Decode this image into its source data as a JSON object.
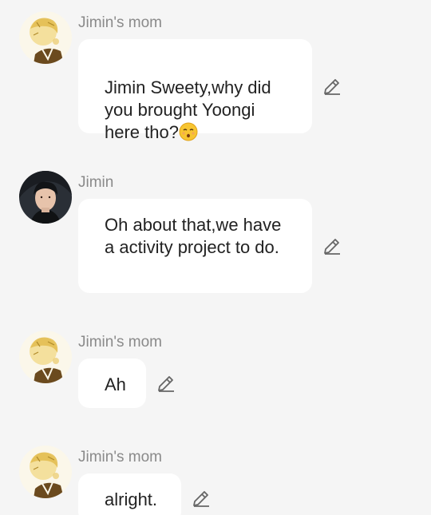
{
  "messages": [
    {
      "sender": "Jimin's mom",
      "text": "Jimin Sweety,why did you brought Yoongi here tho?",
      "emoji": "kissing-face-emoji",
      "avatar": "golden-sketch-avatar"
    },
    {
      "sender": "Jimin",
      "text": "Oh about that,we have a activity project to do.",
      "avatar": "photo-avatar"
    },
    {
      "sender": "Jimin's mom",
      "text": "Ah",
      "avatar": "golden-sketch-avatar"
    },
    {
      "sender": "Jimin's mom",
      "text": "alright.",
      "avatar": "golden-sketch-avatar"
    }
  ],
  "icons": {
    "edit": "pencil-edit-icon"
  },
  "colors": {
    "background": "#f5f5f5",
    "bubble": "#ffffff",
    "sender_name": "#8a8a8a",
    "message_text": "#222222",
    "icon": "#666666"
  }
}
